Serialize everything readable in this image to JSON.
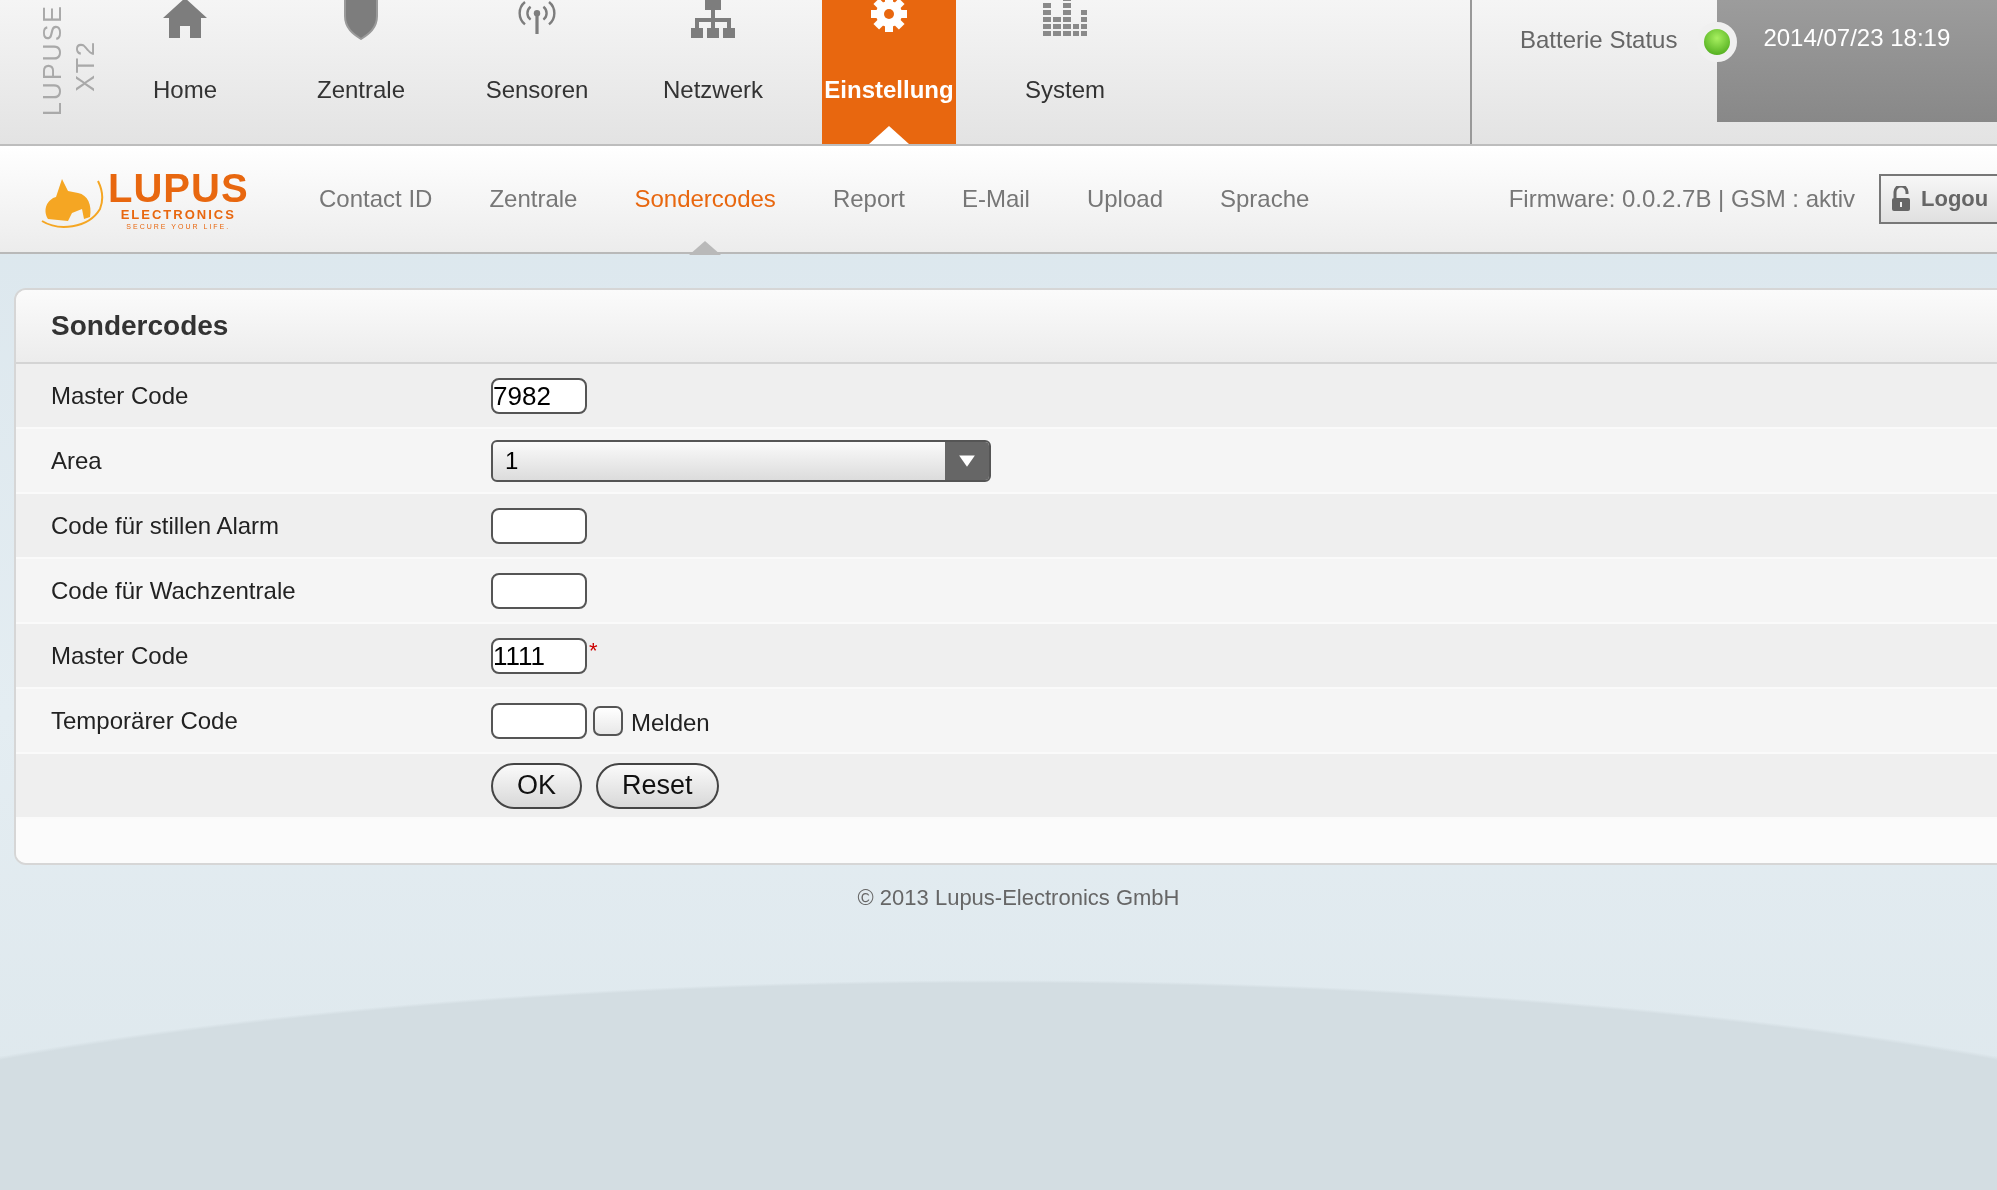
{
  "brand_vertical": [
    "LUPUSE",
    "XT2"
  ],
  "main_nav": [
    {
      "label": "Home",
      "selected": false
    },
    {
      "label": "Zentrale",
      "selected": false
    },
    {
      "label": "Sensoren",
      "selected": false
    },
    {
      "label": "Netzwerk",
      "selected": false
    },
    {
      "label": "Einstellung",
      "selected": true
    },
    {
      "label": "System",
      "selected": false
    }
  ],
  "battery": {
    "label": "Batterie Status",
    "ok": true
  },
  "datetime": "2014/07/23 18:19",
  "logo": {
    "name": "LUPUS",
    "sub": "ELECTRONICS",
    "tagline": "SECURE YOUR LIFE."
  },
  "sub_nav": [
    {
      "label": "Contact ID",
      "selected": false
    },
    {
      "label": "Zentrale",
      "selected": false
    },
    {
      "label": "Sondercodes",
      "selected": true
    },
    {
      "label": "Report",
      "selected": false
    },
    {
      "label": "E-Mail",
      "selected": false
    },
    {
      "label": "Upload",
      "selected": false
    },
    {
      "label": "Sprache",
      "selected": false
    }
  ],
  "firmware": "Firmware: 0.0.2.7B | GSM : aktiv",
  "logout": "Logou",
  "panel": {
    "title": "Sondercodes",
    "rows": [
      {
        "label": "Master Code",
        "kind": "text",
        "value": "7982"
      },
      {
        "label": "Area",
        "kind": "select",
        "value": "1"
      },
      {
        "label": "Code für stillen Alarm",
        "kind": "text"
      },
      {
        "label": "Code für Wachzentrale",
        "kind": "text"
      },
      {
        "label": "Master Code",
        "kind": "text",
        "value": "1111",
        "required_mark": "*"
      },
      {
        "label": "Temporärer Code",
        "kind": "text_checkbox",
        "checkbox": {
          "label": "Melden",
          "checked": false
        }
      }
    ],
    "buttons": [
      "OK",
      "Reset"
    ]
  },
  "footer": "© 2013 Lupus-Electronics GmbH"
}
